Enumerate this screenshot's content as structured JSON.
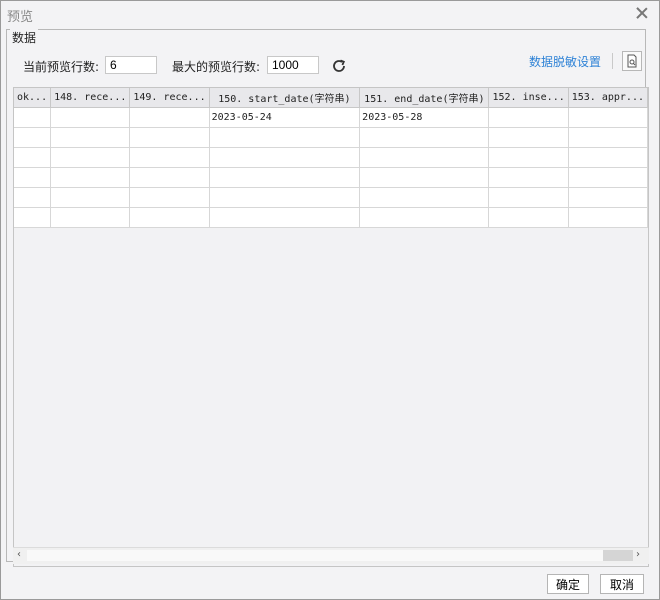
{
  "window": {
    "title": "预览"
  },
  "group": {
    "label": "数据"
  },
  "controls": {
    "current_rows_label": "当前预览行数:",
    "current_rows_value": "6",
    "max_rows_label": "最大的预览行数:",
    "max_rows_value": "1000",
    "mask_link": "数据脱敏设置"
  },
  "table": {
    "columns": [
      "ok...",
      "148. rece...",
      "149. rece...",
      "150. start_date(字符串)",
      "151. end_date(字符串)",
      "152. inse...",
      "153. appr..."
    ],
    "rows": [
      [
        "",
        "",
        "",
        "2023-05-24",
        "2023-05-28",
        "",
        ""
      ],
      [
        "",
        "",
        "",
        "",
        "",
        "",
        ""
      ],
      [
        "",
        "",
        "",
        "",
        "",
        "",
        ""
      ],
      [
        "",
        "",
        "",
        "",
        "",
        "",
        ""
      ],
      [
        "",
        "",
        "",
        "",
        "",
        "",
        ""
      ],
      [
        "",
        "",
        "",
        "",
        "",
        "",
        ""
      ]
    ]
  },
  "buttons": {
    "ok": "确定",
    "cancel": "取消"
  },
  "icons": {
    "close": "close-icon",
    "refresh": "refresh-icon",
    "preview": "document-preview-icon"
  }
}
